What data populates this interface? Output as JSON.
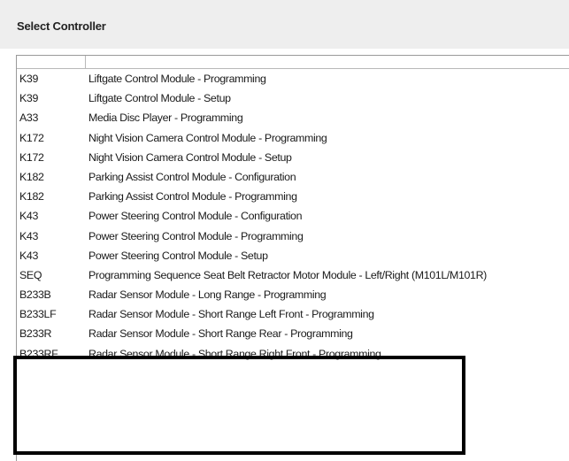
{
  "header": {
    "title": "Select Controller"
  },
  "controllers": [
    {
      "code": "K39",
      "description": "Liftgate Control Module - Programming"
    },
    {
      "code": "K39",
      "description": "Liftgate Control Module - Setup"
    },
    {
      "code": "A33",
      "description": "Media Disc Player - Programming"
    },
    {
      "code": "K172",
      "description": "Night Vision Camera Control Module - Programming"
    },
    {
      "code": "K172",
      "description": "Night Vision Camera Control Module - Setup"
    },
    {
      "code": "K182",
      "description": "Parking Assist Control Module - Configuration"
    },
    {
      "code": "K182",
      "description": "Parking Assist Control Module - Programming"
    },
    {
      "code": "K43",
      "description": "Power Steering Control Module - Configuration"
    },
    {
      "code": "K43",
      "description": "Power Steering Control Module - Programming"
    },
    {
      "code": "K43",
      "description": "Power Steering Control Module - Setup"
    },
    {
      "code": "SEQ",
      "description": "Programming Sequence Seat Belt Retractor Motor Module - Left/Right (M101L/M101R)"
    },
    {
      "code": "B233B",
      "description": "Radar Sensor Module - Long Range - Programming"
    },
    {
      "code": "B233LF",
      "description": "Radar Sensor Module - Short Range Left Front - Programming"
    },
    {
      "code": "B233R",
      "description": "Radar Sensor Module - Short Range Rear - Programming"
    },
    {
      "code": "B233RF",
      "description": "Radar Sensor Module - Short Range Right Front - Programming"
    }
  ],
  "highlight_color": "#000000"
}
